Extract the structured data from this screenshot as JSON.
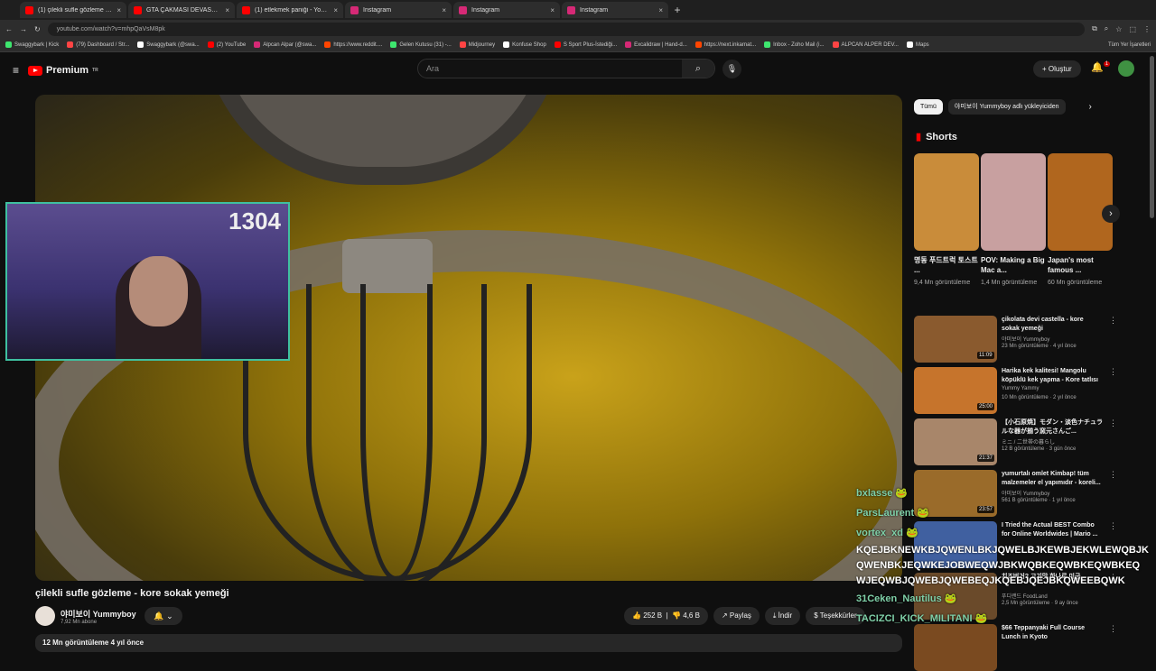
{
  "tabs": [
    {
      "title": "(1) çilekli sufle gözleme - k",
      "color": "#ff0000"
    },
    {
      "title": "GTA ÇAKMASI DEVASA OYUNU",
      "color": "#ff0000"
    },
    {
      "title": "(1) etlekmek paniği - YouTube",
      "color": "#ff0000"
    },
    {
      "title": "Instagram",
      "color": "#d62976"
    },
    {
      "title": "Instagram",
      "color": "#d62976"
    },
    {
      "title": "Instagram",
      "color": "#d62976"
    }
  ],
  "url": "youtube.com/watch?v=mhpQaVsM8pk",
  "bookmarks": [
    "Swaggybark | Kick",
    "(79) Dashboard / Str...",
    "Swaggybark (@swa...",
    "(2) YouTube",
    "Alpcan Alpar (@swa...",
    "https://www.reddit....",
    "Gelen Kutusu (31) -...",
    "Midjourney",
    "Konfuse Shop",
    "S Sport Plus-İstediği...",
    "Excalidraw | Hand-d...",
    "https://next.inkarnat...",
    "Inbox - Zoho Mail (i...",
    "ALPCAN ALPER DEV...",
    "Maps"
  ],
  "bookmarks_right": "Tüm Yer İşaretleri",
  "header": {
    "logo": "Premium",
    "logo_sup": "TR",
    "search_placeholder": "Ara",
    "create": "Oluştur",
    "bell_badge": "1"
  },
  "overlay": {
    "counter": "1304"
  },
  "video": {
    "title": "çilekli sufle gözleme - kore sokak yemeği",
    "channel": "야미보이 Yummyboy",
    "subs": "7,92 Mn abone",
    "likes": "252 B",
    "dislikes": "4,6 B",
    "share": "Paylaş",
    "download": "İndir",
    "thanks": "Teşekkürler",
    "views_line": "12 Mn görüntüleme  4 yıl önce"
  },
  "chips": [
    "Tümü",
    "야미보이 Yummyboy adlı yükleyiciden"
  ],
  "shorts_title": "Shorts",
  "shorts": [
    {
      "title": "명동 푸드트럭 토스트 ...",
      "views": "9,4 Mn görüntüleme",
      "color": "#c98c3a"
    },
    {
      "title": "POV: Making a Big Mac a...",
      "views": "1,4 Mn görüntüleme",
      "color": "#c8a0a0"
    },
    {
      "title": "Japan's most famous ...",
      "views": "60 Mn görüntüleme",
      "color": "#b0661e"
    }
  ],
  "recs": [
    {
      "title": "çikolata devi castella - kore sokak yemeği",
      "channel": "야미보이 Yummyboy",
      "meta": "23 Mn görüntüleme · 4 yıl önce",
      "dur": "11:09",
      "color": "#8a5a2e"
    },
    {
      "title": "Harika kek kalitesi! Mangolu köpüklü kek yapma - Kore tatlısı",
      "channel": "Yummy Yammy",
      "meta": "10 Mn görüntüleme · 2 yıl önce",
      "dur": "25:00",
      "color": "#c6742c"
    },
    {
      "title": "【小石原焼】モダン・淡色ナチュラルな器が揃う窯元さんご...",
      "channel": "ミニ / 二世帯の暮らし",
      "meta": "12 B görüntüleme · 3 gün önce",
      "dur": "21:37",
      "color": "#a8866a"
    },
    {
      "title": "yumurtalı omlet Kimbap! tüm malzemeler el yapımıdır - koreli...",
      "channel": "야미보이 Yummyboy",
      "meta": "561 B görüntüleme · 1 yıl önce",
      "dur": "23:57",
      "color": "#9a6b2a"
    },
    {
      "title": "I Tried the Actual BEST Combo for Online Worldwides | Mario ...",
      "channel": "",
      "meta": "",
      "dur": "",
      "color": "#4060a0"
    },
    {
      "title": "치즈버거? 고기맛 하나로 미군...",
      "channel": "푸디랜드 FoodLand",
      "meta": "2,5 Mn görüntüleme · 9 ay önce",
      "dur": "",
      "color": "#6a4a2a"
    },
    {
      "title": "$66 Teppanyaki Full Course Lunch in Kyoto",
      "channel": "",
      "meta": "",
      "dur": "",
      "color": "#7a4a20"
    }
  ],
  "chat": {
    "lines": [
      "bxlasse",
      "ParsLaurent",
      "vortex_xd",
      "31Ceken_Nautilus",
      "TACIZCI_KICK_MILITANI"
    ],
    "spam": [
      "KQEJBKNEWKBJQWENLBKJQWELBJKEWBJEKWLEWQBJK",
      "QWENBKJEQWKEJOBWEQWJBKWQBKEQWBKEQWBKEQ",
      "WJEQWBJQWEBJQWEBEQJKQEBJQEJBKQWEEBQWK"
    ]
  }
}
